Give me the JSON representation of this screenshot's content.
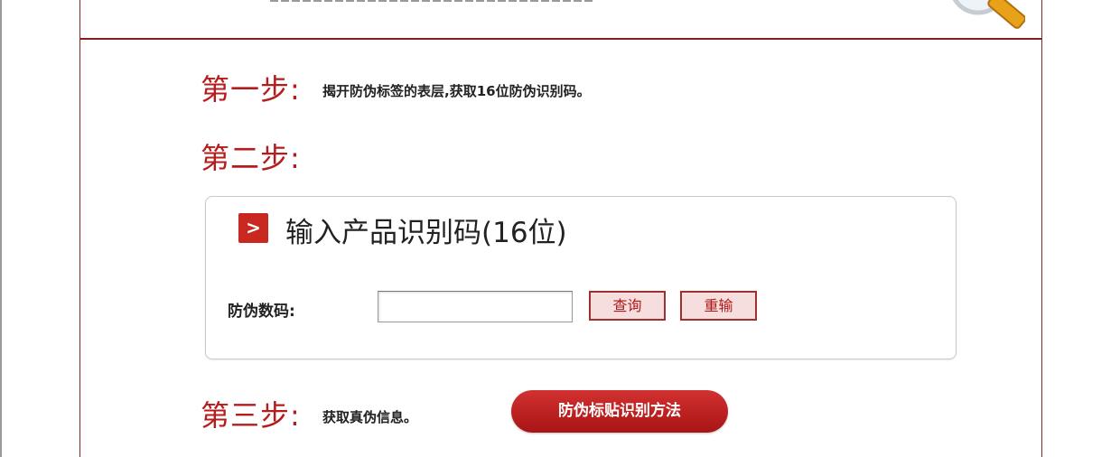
{
  "steps": {
    "step1": {
      "title": "第一步:",
      "text": "揭开防伪标签的表层,获取16位防伪识别码。"
    },
    "step2": {
      "title": "第二步:"
    },
    "step3": {
      "title": "第三步:",
      "text": "获取真伪信息。"
    }
  },
  "query_box": {
    "icon": "chevron-right-icon",
    "icon_glyph": ">",
    "heading": "输入产品识别码(16位)",
    "field_label": "防伪数码:",
    "input_value": "",
    "query_label": "查询",
    "reset_label": "重输"
  },
  "method_button_label": "防伪标贴识别方法",
  "colors": {
    "accent_red": "#b51c1c",
    "button_red": "#c8281f",
    "button_pink_bg": "#f6dede",
    "border_dark_red": "#7d2a2a"
  }
}
